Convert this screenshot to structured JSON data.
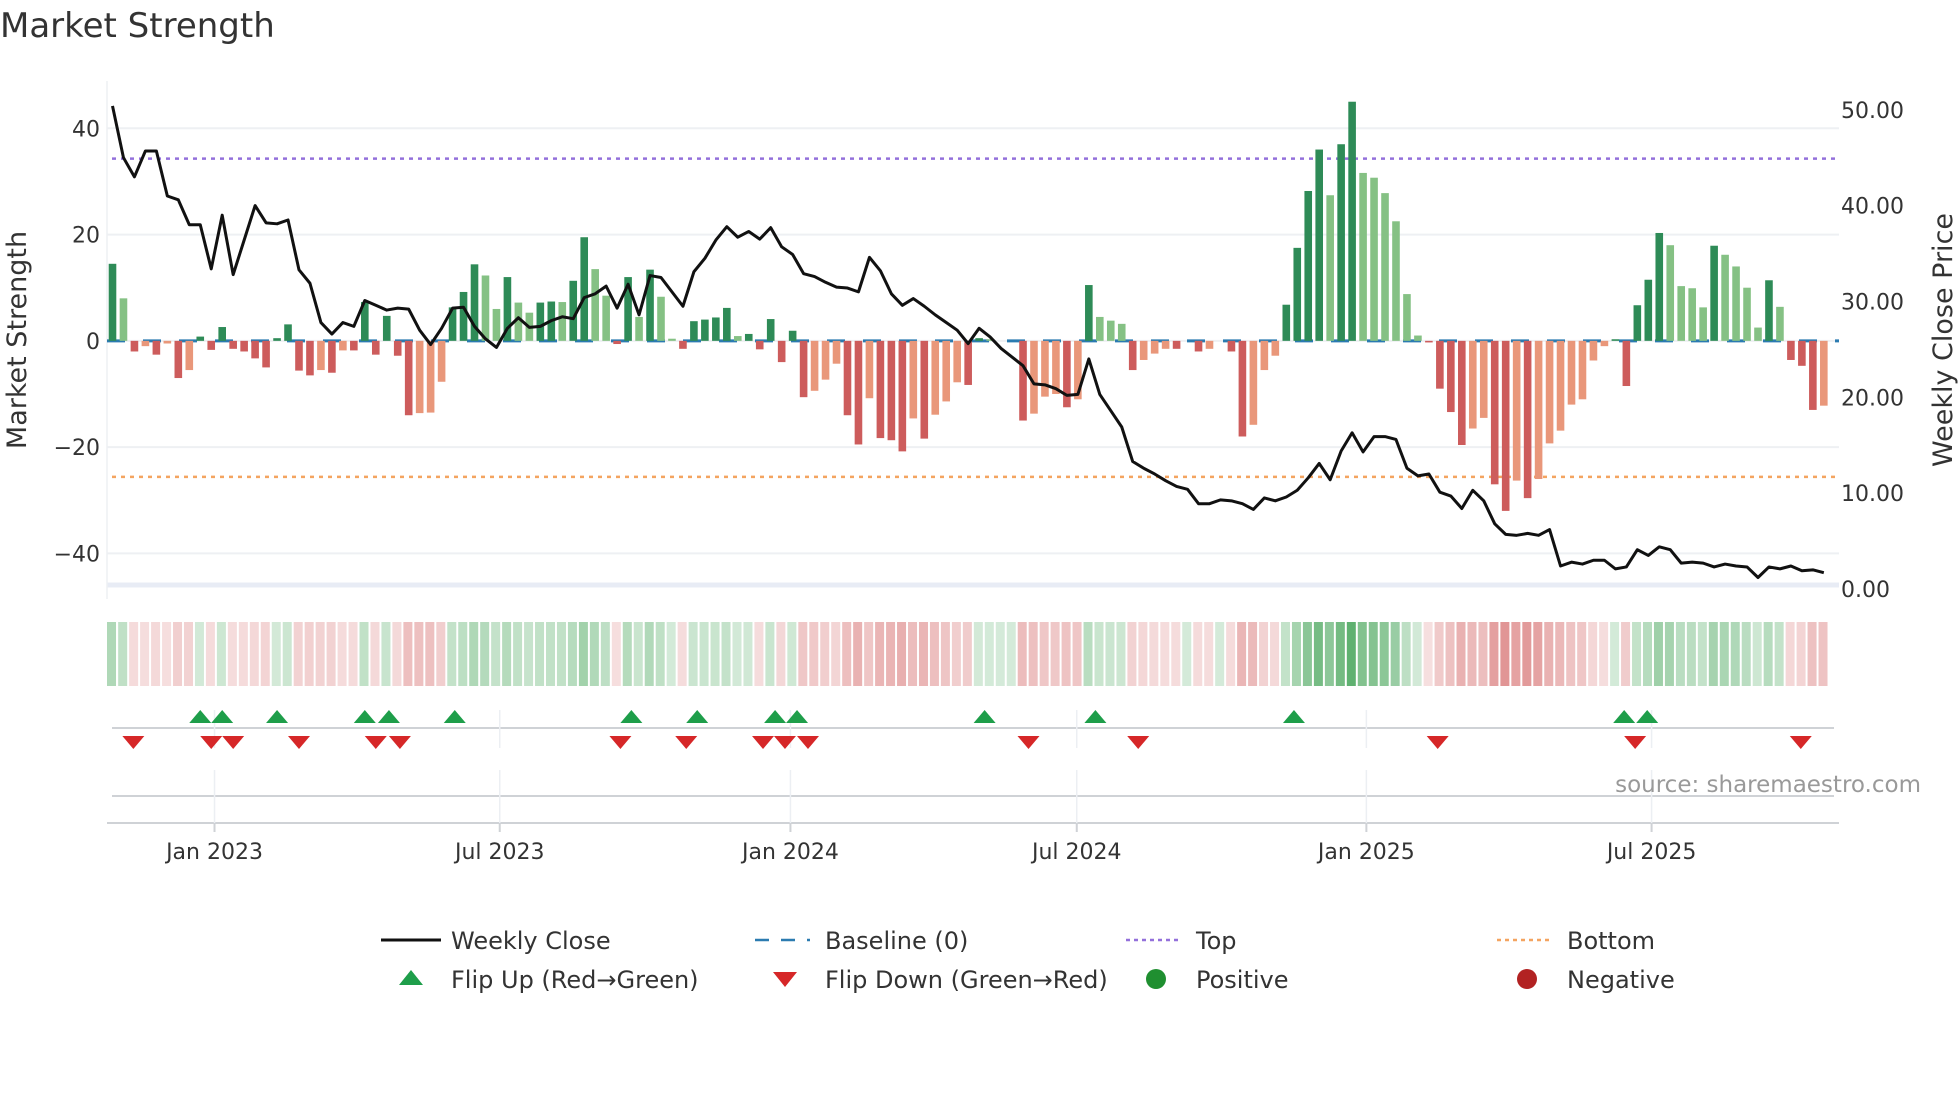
{
  "chart_data": {
    "type": "bar",
    "title": "Market Strength",
    "ylabel": "Market Strength",
    "y2label": "Weekly Close Price",
    "ylim": [
      -46.7,
      48.9
    ],
    "y2lim": [
      0,
      53
    ],
    "yticks": [
      40,
      20,
      0,
      -20,
      -40
    ],
    "yticklabels": [
      "40",
      "20",
      "0",
      "−20",
      "−40"
    ],
    "y2ticks": [
      50,
      40,
      30,
      20,
      10,
      0
    ],
    "y2ticklabels": [
      "50.00",
      "40.00",
      "30.00",
      "20.00",
      "10.00",
      "0.00"
    ],
    "xticks": [
      {
        "label": "Jan 2023",
        "week": 9.3
      },
      {
        "label": "Jul 2023",
        "week": 35.3
      },
      {
        "label": "Jan 2024",
        "week": 61.8
      },
      {
        "label": "Jul 2024",
        "week": 87.9
      },
      {
        "label": "Jan 2025",
        "week": 114.3
      },
      {
        "label": "Jul 2025",
        "week": 140.3
      }
    ],
    "top_level": 34.3,
    "bottom_level": -25.6,
    "baseline": 0,
    "strength": [
      14.5,
      8,
      -2,
      -1,
      -2.6,
      -0.5,
      -7,
      -5.5,
      0.8,
      -1.7,
      2.6,
      -1.5,
      -2,
      -3.3,
      -5,
      0.5,
      3.1,
      -5.6,
      -6.5,
      -5.5,
      -6,
      -1.8,
      -1.8,
      7.3,
      -2.6,
      4.7,
      -2.8,
      -14,
      -13.6,
      -13.5,
      -7.7,
      6.3,
      9.2,
      14.4,
      12.3,
      6,
      12,
      7.2,
      5.3,
      7.2,
      7.4,
      7.3,
      11.3,
      19.5,
      13.5,
      8.5,
      -0.6,
      12,
      4.5,
      13.4,
      8.3,
      0.4,
      -1.5,
      3.7,
      4,
      4.4,
      6.2,
      0.9,
      1.3,
      -1.6,
      4.1,
      -4,
      1.9,
      -10.6,
      -9.4,
      -7.3,
      -4.3,
      -14,
      -19.5,
      -10.8,
      -18.3,
      -18.7,
      -20.8,
      -14.6,
      -18.4,
      -13.9,
      -11.4,
      -7.8,
      -8.3,
      0.5,
      0.3,
      0,
      0,
      -15,
      -13.7,
      -10.5,
      -10,
      -12.5,
      -11,
      10.5,
      4.5,
      3.8,
      3.2,
      -5.5,
      -3.6,
      -2.4,
      -1.5,
      -1.5,
      0,
      -2,
      -1.5,
      0,
      -2,
      -18,
      -15.8,
      -5.5,
      -2.8,
      6.8,
      17.5,
      28.2,
      36,
      27.4,
      37,
      45,
      31.6,
      30.7,
      27.8,
      22.5,
      8.8,
      1,
      -0.3,
      -9,
      -13.4,
      -19.6,
      -16.5,
      -14.5,
      -27,
      -32,
      -26.3,
      -29.6,
      -26,
      -19.3,
      -16.9,
      -12,
      -11,
      -3.7,
      -1,
      0.3,
      -8.5,
      6.7,
      11.5,
      20.3,
      18,
      10.3,
      9.9,
      6.3,
      17.9,
      16.2,
      14,
      10,
      2.5,
      11.4,
      6.4,
      -3.6,
      -4.7,
      -13,
      -12.2
    ],
    "weekly_close": [
      50.4,
      45,
      43,
      45.7,
      45.7,
      41,
      40.6,
      38,
      38,
      33.4,
      39,
      32.8,
      36.4,
      40,
      38.2,
      38.1,
      38.5,
      33.3,
      31.9,
      27.8,
      26.6,
      27.8,
      27.4,
      30.1,
      29.6,
      29.1,
      29.3,
      29.2,
      27,
      25.5,
      27.2,
      29.3,
      29.4,
      27.4,
      26.1,
      25.2,
      27.2,
      28.3,
      27.3,
      27.4,
      28,
      28.4,
      28.2,
      30.4,
      30.8,
      31.6,
      29.3,
      31.8,
      28.6,
      32.7,
      32.5,
      31,
      29.5,
      33.1,
      34.5,
      36.4,
      37.8,
      36.7,
      37.3,
      36.5,
      37.7,
      35.7,
      34.9,
      32.9,
      32.6,
      32,
      31.5,
      31.4,
      31,
      34.6,
      33.2,
      30.8,
      29.6,
      30.3,
      29.5,
      28.6,
      27.8,
      27,
      25.6,
      27.2,
      26.3,
      25.1,
      24.2,
      23.3,
      21.4,
      21.3,
      20.9,
      20.2,
      20.3,
      24,
      20.3,
      18.6,
      16.9,
      13.3,
      12.6,
      12,
      11.3,
      10.7,
      10.4,
      8.9,
      8.9,
      9.3,
      9.2,
      8.9,
      8.3,
      9.5,
      9.2,
      9.6,
      10.3,
      11.6,
      13.1,
      11.4,
      14.4,
      16.3,
      14.3,
      15.9,
      15.9,
      15.6,
      12.6,
      11.8,
      12,
      10.1,
      9.7,
      8.4,
      10.3,
      9.2,
      6.8,
      5.7,
      5.6,
      5.8,
      5.6,
      6.2,
      2.4,
      2.8,
      2.6,
      3,
      3,
      2.1,
      2.3,
      4.1,
      3.5,
      4.4,
      4.1,
      2.7,
      2.8,
      2.7,
      2.3,
      2.6,
      2.4,
      2.3,
      1.2,
      2.3,
      2.1,
      2.4,
      1.9,
      2,
      1.7
    ],
    "flip_up_weeks": [
      8,
      10,
      15,
      23,
      25.2,
      31.2,
      47.3,
      53.3,
      60.4,
      62.4,
      79.5,
      89.6,
      107.7,
      137.8,
      139.9
    ],
    "flip_down_weeks": [
      1.9,
      9,
      11,
      17,
      24,
      26.2,
      46.3,
      52.3,
      59.3,
      61.3,
      63.4,
      83.5,
      93.5,
      120.8,
      138.8,
      153.9
    ],
    "legend": [
      {
        "label": "Weekly Close",
        "kind": "line"
      },
      {
        "label": "Baseline (0)",
        "kind": "dash"
      },
      {
        "label": "Top",
        "kind": "dot-top"
      },
      {
        "label": "Bottom",
        "kind": "dot-bottom"
      },
      {
        "label": "Flip Up (Red→Green)",
        "kind": "tri-up"
      },
      {
        "label": "Flip Down (Green→Red)",
        "kind": "tri-down"
      },
      {
        "label": "Positive",
        "kind": "circle-pos"
      },
      {
        "label": "Negative",
        "kind": "circle-neg"
      }
    ],
    "legend_position": "bottom",
    "source": "source: sharemaestro.com",
    "colors": {
      "pos_strong": "#2e8b57",
      "pos_weak": "#85c184",
      "neg_strong": "#cd5c5c",
      "neg_weak": "#e9977a",
      "baseline": "#2b7bb0",
      "top": "#9370db",
      "bottom": "#f4a460",
      "line": "#111111",
      "flip_up": "#1e9e4a",
      "flip_down": "#d62728",
      "positive": "#1f8f30",
      "negative": "#b22222"
    }
  }
}
